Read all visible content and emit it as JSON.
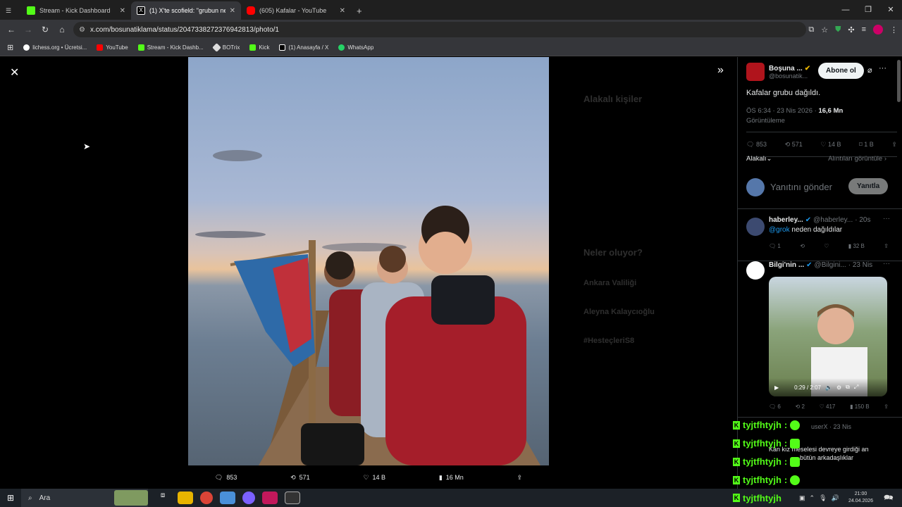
{
  "tabs": [
    {
      "label": "Stream - Kick Dashboard",
      "color": "#53fc18"
    },
    {
      "label": "(1) X'te scofield: \"grubun neden",
      "color": "#000000"
    },
    {
      "label": "(605) Kafalar - YouTube",
      "color": "#ff0000"
    }
  ],
  "address": {
    "url": "x.com/bosunatiklama/status/2047338272376942813/photo/1"
  },
  "bookmarks": [
    {
      "label": "lichess.org • Ücretsi...",
      "color": "#ffffff"
    },
    {
      "label": "YouTube",
      "color": "#ff0000"
    },
    {
      "label": "Stream - Kick Dashb...",
      "color": "#53fc18"
    },
    {
      "label": "BOTrix",
      "color": "#dddddd"
    },
    {
      "label": "Kick",
      "color": "#53fc18"
    },
    {
      "label": "(1) Anasayfa / X",
      "color": "#000000"
    },
    {
      "label": "WhatsApp",
      "color": "#25d366"
    }
  ],
  "photo_actions": {
    "replies": "853",
    "reposts": "571",
    "likes": "14 B",
    "views": "16 Mn"
  },
  "post": {
    "author_name": "Boşuna ...",
    "author_handle": "@bosunatik...",
    "follow": "Abone ol",
    "text": "Kafalar grubu dağıldı.",
    "meta": "ÖS 6:34 · 23 Nis 2026 · ",
    "views_count": "16,6 Mn",
    "views_label": "Görüntüleme",
    "replies": "853",
    "reposts": "571",
    "likes": "14 B",
    "bookmarks": "1 B",
    "sort": "Alakalı",
    "quotes": "Alıntıları görüntüle",
    "reply_placeholder": "Yanıtını gönder",
    "reply_button": "Yanıtla"
  },
  "replies": [
    {
      "name": "haberley...",
      "handle": "@haberley...",
      "time": "· 20s",
      "mention": "@grok",
      "text": " neden dağıldılar",
      "replies": "1",
      "likes": "",
      "views": "32 B"
    },
    {
      "name": "Bilgi'nin ...",
      "handle": "@Bilgini...",
      "time": "· 23 Nis",
      "video_time": "0:29 / 2:07",
      "replies": "6",
      "reposts": "2",
      "likes": "417",
      "views": "150 B"
    }
  ],
  "overlay_reply": {
    "handle": "userX · 23 Nis",
    "line1": "Kan kız meselesi devreye girdiği an",
    "line2": "bütün arkadaşlıklar"
  },
  "chat": [
    {
      "user": "tyjtfhtyjh",
      "sep": ":"
    },
    {
      "user": "tyjtfhtyjh",
      "sep": ":"
    },
    {
      "user": "tyjtfhtyjh",
      "sep": ":"
    },
    {
      "user": "tyjtfhtyjh",
      "sep": ":"
    },
    {
      "user": "tyjtfhtyjh",
      "sep": ""
    }
  ],
  "dim_sidebar": {
    "related": "Alakalı kişiler",
    "trending": "Neler oluyor?",
    "trend1": "Ankara Valiliği",
    "trend2": "Aleyna Kalaycıoğlu",
    "trend3": "#HesteçleriS8"
  },
  "taskbar": {
    "search": "Ara",
    "time": "21:00",
    "date": "24.04.2026"
  }
}
